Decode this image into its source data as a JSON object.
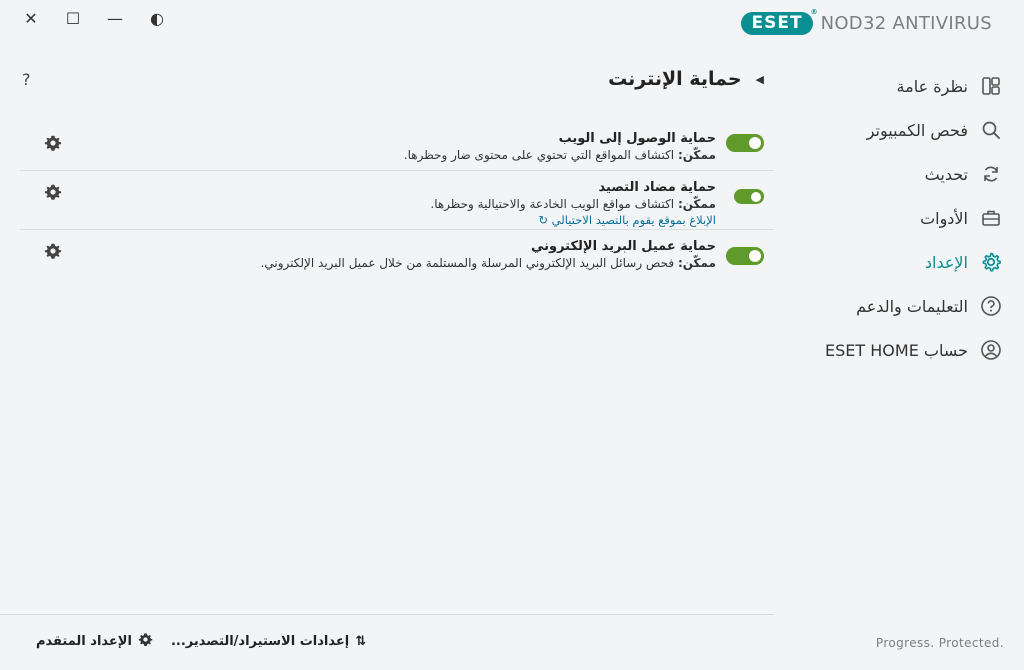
{
  "window": {
    "close_glyph": "✕",
    "maximize_glyph": "☐",
    "minimize_glyph": "—",
    "theme_glyph": "◐"
  },
  "brand": {
    "logo_text": "ESET",
    "product": "NOD32 ANTIVIRUS",
    "accent": "#0a8f93"
  },
  "sidebar": {
    "items": [
      {
        "label": "نظرة عامة",
        "icon": "overview-icon"
      },
      {
        "label": "فحص الكمبيوتر",
        "icon": "search-icon"
      },
      {
        "label": "تحديث",
        "icon": "refresh-icon"
      },
      {
        "label": "الأدوات",
        "icon": "toolbox-icon"
      },
      {
        "label": "الإعداد",
        "icon": "gear-icon",
        "active": true
      },
      {
        "label": "التعليمات والدعم",
        "icon": "help-icon"
      },
      {
        "label": "حساب ESET HOME",
        "icon": "account-icon"
      }
    ]
  },
  "main": {
    "help_glyph": "?",
    "title": "حماية الإنترنت",
    "settings": [
      {
        "name": "حماية الوصول إلى الويب",
        "status": "ممكّن:",
        "desc": " اكتشاف المواقع التي تحتوي على محتوى ضار وحظرها.",
        "enabled": true
      },
      {
        "name": "حماية مضاد التصيد",
        "status": "ممكّن:",
        "desc": " اكتشاف مواقع الويب الخادعة والاحتيالية وحظرها.",
        "link": "الإبلاغ بموقع يقوم بالتصيد الاحتيالي",
        "enabled": true
      },
      {
        "name": "حماية عميل البريد الإلكتروني",
        "status": "ممكّن:",
        "desc": " فحص رسائل البريد الإلكتروني المرسلة والمستلمة من خلال عميل البريد الإلكتروني.",
        "enabled": true
      }
    ],
    "toggle_color": "#5f9a2a"
  },
  "footer": {
    "import_export": "إعدادات الاستيراد/التصدير...",
    "advanced": "الإعداد المتقدم",
    "status": "Progress. Protected."
  }
}
